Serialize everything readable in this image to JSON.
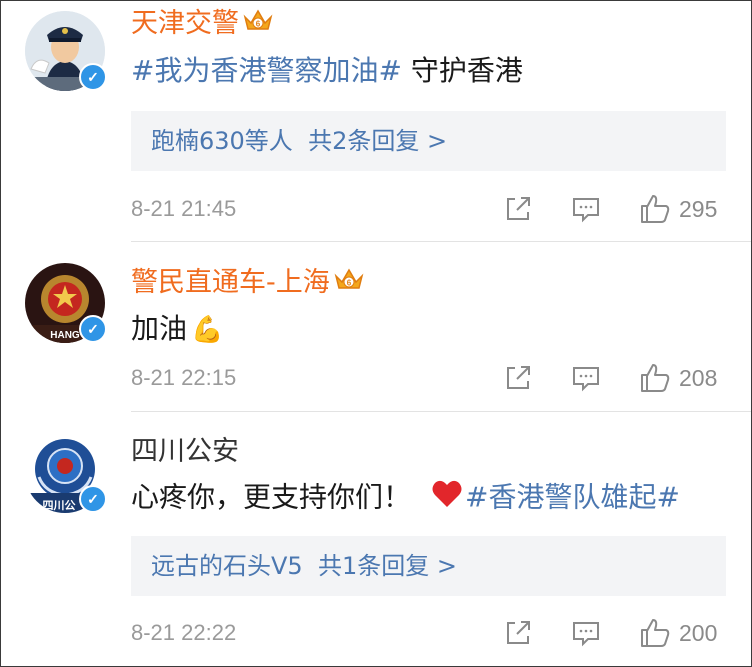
{
  "comments": [
    {
      "author": "天津交警",
      "text_topic": "#我为香港警察加油#",
      "text_rest": " 守护香港",
      "reply_users": "跑楠630等人",
      "reply_count": "共2条回复 >",
      "time": "8-21 21:45",
      "likes": "295"
    },
    {
      "author": "警民直通车-上海",
      "text": "加油",
      "emoji": "💪",
      "time": "8-21 22:15",
      "likes": "208"
    },
    {
      "author": "四川公安",
      "text_pre": "心疼你，更支持你们！",
      "text_topic": "#香港警队雄起#",
      "reply_users": "远古的石头V5",
      "reply_count": "共1条回复 >",
      "time": "8-21 22:22",
      "likes": "200"
    }
  ],
  "avatar_labels": {
    "shanghai": "HANG",
    "sichuan": "四川公"
  },
  "icons": {
    "verified": "✓",
    "share": "share-icon",
    "comment": "comment-icon",
    "like": "like-icon",
    "crown": "crown-badge-icon"
  },
  "colors": {
    "name_orange": "#f06c1f",
    "link_blue": "#4b77b0",
    "verified_blue": "#2f95e6",
    "reply_bg": "#f3f4f6",
    "time_gray": "#9a9a9a"
  }
}
